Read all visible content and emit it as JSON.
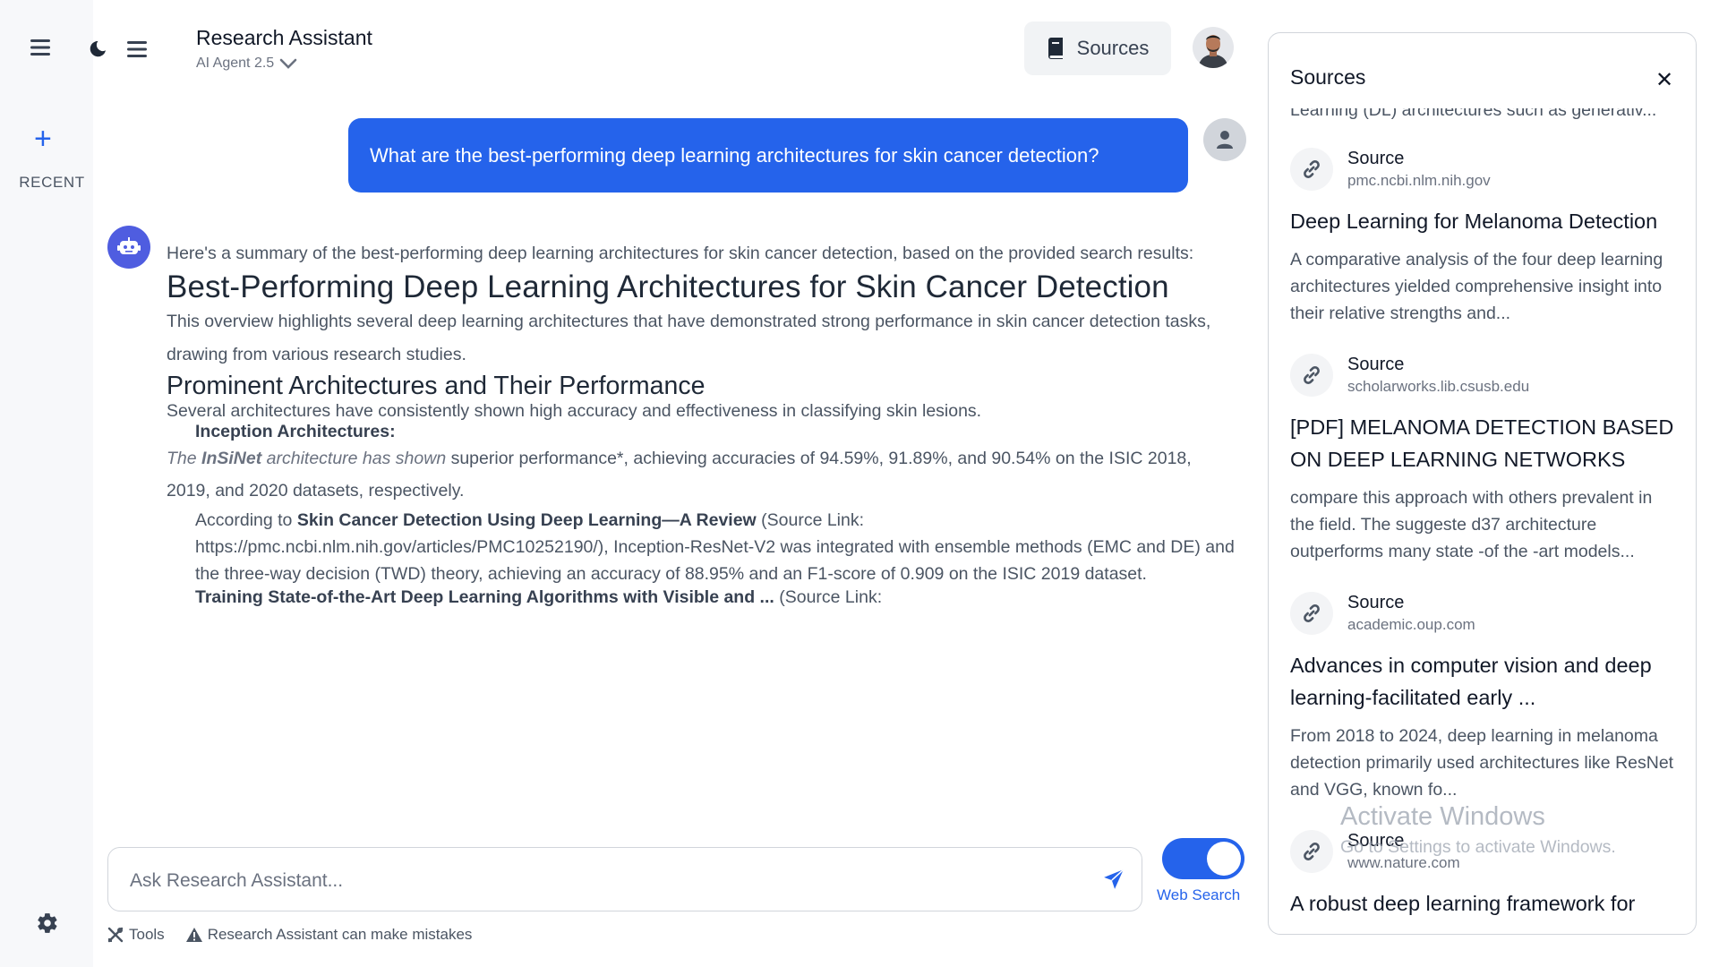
{
  "rail": {
    "recent_label": "RECENT"
  },
  "header": {
    "title": "Research Assistant",
    "model": "AI Agent 2.5",
    "sources_button": "Sources"
  },
  "chat": {
    "user_message": "What are the best-performing deep learning architectures for skin cancer detection?",
    "answer": {
      "intro": "Here's a summary of the best-performing deep learning architectures for skin cancer detection, based on the provided search results:",
      "heading": "Best-Performing Deep Learning Architectures for Skin Cancer Detection",
      "lead": "This overview highlights several deep learning architectures that have demonstrated strong performance in skin cancer detection tasks, drawing from various research studies.",
      "subheading": "Prominent Architectures and Their Performance",
      "para": "Several architectures have consistently shown high accuracy and effectiveness in classifying skin lesions.",
      "section_label": "Inception Architectures:",
      "insinet_pre": "The ",
      "insinet_name": "InSiNet",
      "insinet_mid": " architecture has shown",
      "insinet_rest": " superior performance*, achieving accuracies of 94.59%, 91.89%, and 90.54% on the ISIC 2018, 2019, and 2020 datasets, respectively.",
      "ref1_pre": "According to ",
      "ref1_title": "Skin Cancer Detection Using Deep Learning—A Review",
      "ref1_rest": " (Source Link: https://pmc.ncbi.nlm.nih.gov/articles/PMC10252190/), Inception-ResNet-V2 was integrated with ensemble methods (EMC and DE) and the three-way decision (TWD) theory, achieving an accuracy of 88.95% and an F1-score of 0.909 on the ISIC 2019 dataset.",
      "ref2_title": "Training State-of-the-Art Deep Learning Algorithms with Visible and ...",
      "ref2_rest": " (Source Link:"
    }
  },
  "composer": {
    "placeholder": "Ask Research Assistant...",
    "web_search_label": "Web Search",
    "web_search_on": true
  },
  "footer": {
    "tools": "Tools",
    "disclaimer": "Research Assistant can make mistakes"
  },
  "sources_panel": {
    "title": "Sources",
    "cut_line": "Learning (DL) architectures such as generativ...",
    "items": [
      {
        "label": "Source",
        "domain": "pmc.ncbi.nlm.nih.gov",
        "title": "Deep Learning for Melanoma Detection",
        "snippet": "A comparative analysis of the four deep learning architectures yielded comprehensive insight into their relative strengths and..."
      },
      {
        "label": "Source",
        "domain": "scholarworks.lib.csusb.edu",
        "title": "[PDF] MELANOMA DETECTION BASED ON DEEP LEARNING NETWORKS",
        "snippet": "compare this approach with others prevalent in the field. The suggeste d37 architecture outperforms many state -of the -art models..."
      },
      {
        "label": "Source",
        "domain": "academic.oup.com",
        "title": "Advances in computer vision and deep learning-facilitated early ...",
        "snippet": "From 2018 to 2024, deep learning in melanoma detection primarily used architectures like ResNet and VGG, known fo..."
      },
      {
        "label": "Source",
        "domain": "www.nature.com",
        "title": "A robust deep learning framework for",
        "snippet": ""
      }
    ]
  },
  "watermark": {
    "line1": "Activate Windows",
    "line2": "Go to Settings to activate Windows."
  },
  "colors": {
    "accent": "#2563eb",
    "bot_avatar": "#4f5de0"
  }
}
